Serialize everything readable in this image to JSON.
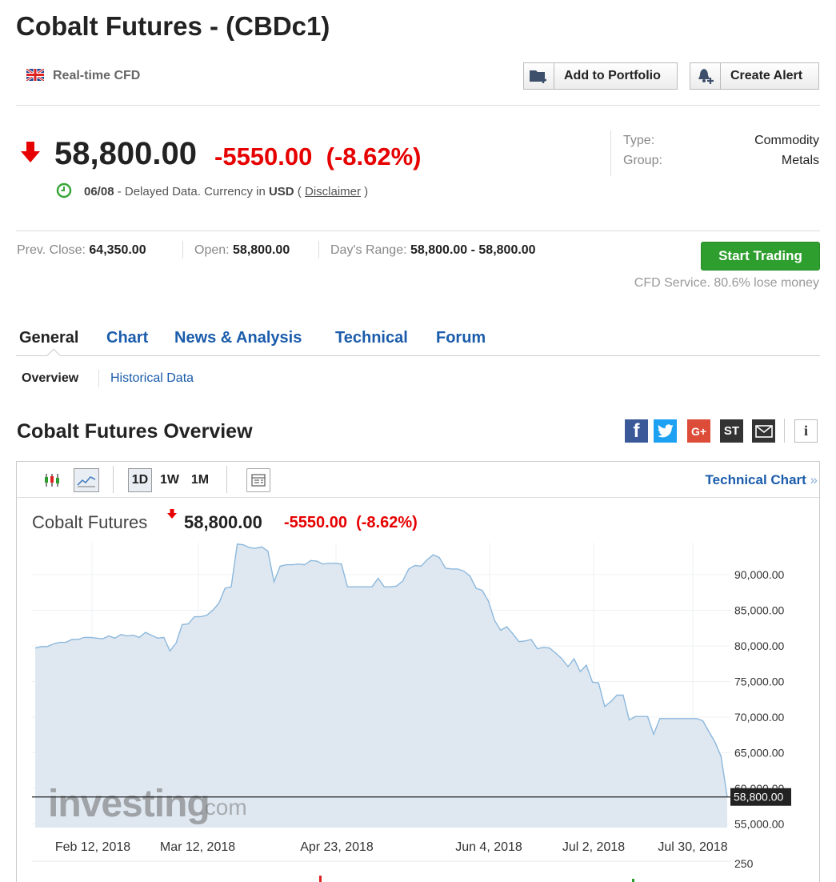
{
  "page": {
    "title": "Cobalt Futures - (CBDc1)",
    "realtime_label": "Real-time CFD"
  },
  "buttons": {
    "add_portfolio": "Add to Portfolio",
    "create_alert": "Create Alert",
    "start_trading": "Start Trading"
  },
  "quote": {
    "price": "58,800.00",
    "change": "-5550.00",
    "change_pct": "(-8.62%)",
    "date": "06/08",
    "delayed_text": " - Delayed Data. Currency in ",
    "currency": "USD",
    "paren_open": " ( ",
    "disclaimer": "Disclaimer",
    "paren_close": " )"
  },
  "info": {
    "type_label": "Type:",
    "type_value": "Commodity",
    "group_label": "Group:",
    "group_value": "Metals"
  },
  "stats": {
    "prev_close_label": "Prev. Close: ",
    "prev_close": "64,350.00",
    "open_label": "Open: ",
    "open": "58,800.00",
    "range_label": "Day's Range: ",
    "range": "58,800.00 - 58,800.00",
    "cfd_note": "CFD Service. 80.6% lose money"
  },
  "tabs": [
    {
      "label": "General",
      "active": true
    },
    {
      "label": "Chart",
      "active": false
    },
    {
      "label": "News & Analysis",
      "active": false
    },
    {
      "label": "Technical",
      "active": false
    },
    {
      "label": "Forum",
      "active": false
    }
  ],
  "subtabs": {
    "overview": "Overview",
    "historical": "Historical Data"
  },
  "overview": {
    "title": "Cobalt Futures Overview",
    "social": [
      {
        "name": "facebook-icon",
        "glyph": "f",
        "color": "#3b5998"
      },
      {
        "name": "twitter-icon",
        "glyph": "t",
        "color": "#1da1f2"
      },
      {
        "name": "google-plus-icon",
        "glyph": "G+",
        "color": "#dd4b39"
      },
      {
        "name": "stocktwits-icon",
        "glyph": "ST",
        "color": "#333333"
      },
      {
        "name": "email-icon",
        "glyph": "✉",
        "color": "#333333"
      },
      {
        "name": "info-icon",
        "glyph": "i",
        "color": "#ffffff"
      }
    ]
  },
  "toolbar": {
    "tf_1d": "1D",
    "tf_1w": "1W",
    "tf_1m": "1M",
    "technical_chart": "Technical Chart",
    "technical_arrows": " »"
  },
  "chart_header": {
    "name": "Cobalt Futures",
    "price": "58,800.00",
    "change": "-5550.00",
    "change_pct": "(-8.62%)"
  },
  "chart_data": {
    "type": "area",
    "x_tick_labels": [
      "Feb 12, 2018",
      "Mar 12, 2018",
      "Apr 23, 2018",
      "Jun 4, 2018",
      "Jul 2, 2018",
      "Jul 30, 2018"
    ],
    "y_tick_labels": [
      "90,000.00",
      "85,000.00",
      "80,000.00",
      "75,000.00",
      "70,000.00",
      "65,000.00",
      "60,000.00",
      "55,000.00"
    ],
    "y_ticks": [
      90000,
      85000,
      80000,
      75000,
      70000,
      65000,
      60000,
      55000
    ],
    "ylim": [
      54500,
      94500
    ],
    "last_value_label": "58,800.00",
    "last_value": 58800,
    "volume_axis_label": "250",
    "watermark": "investing.com",
    "values": [
      79700,
      79900,
      79900,
      80300,
      80500,
      80500,
      80900,
      80900,
      81200,
      81200,
      81100,
      81000,
      81400,
      81100,
      81600,
      81400,
      81500,
      81200,
      81900,
      81500,
      81100,
      81200,
      79300,
      80400,
      83000,
      83100,
      84100,
      84100,
      84300,
      85000,
      86000,
      88100,
      88300,
      94300,
      94200,
      93800,
      93700,
      93900,
      93300,
      89000,
      91200,
      91400,
      91400,
      91500,
      91400,
      92000,
      91900,
      91500,
      91600,
      91600,
      91500,
      88300,
      88300,
      88300,
      88300,
      88300,
      89500,
      88300,
      88300,
      88400,
      89100,
      90800,
      91300,
      91200,
      92100,
      92800,
      92400,
      90900,
      90800,
      90800,
      90500,
      89800,
      88100,
      87800,
      86300,
      83600,
      82200,
      82700,
      81700,
      80600,
      80700,
      80900,
      79600,
      79800,
      79700,
      79000,
      78200,
      77100,
      78200,
      76400,
      77300,
      74900,
      74800,
      71500,
      72200,
      73100,
      73100,
      69600,
      70100,
      70100,
      70100,
      67600,
      69800,
      69800,
      69800,
      69800,
      69800,
      69800,
      69800,
      69500,
      68000,
      66500,
      64500,
      58800
    ]
  }
}
